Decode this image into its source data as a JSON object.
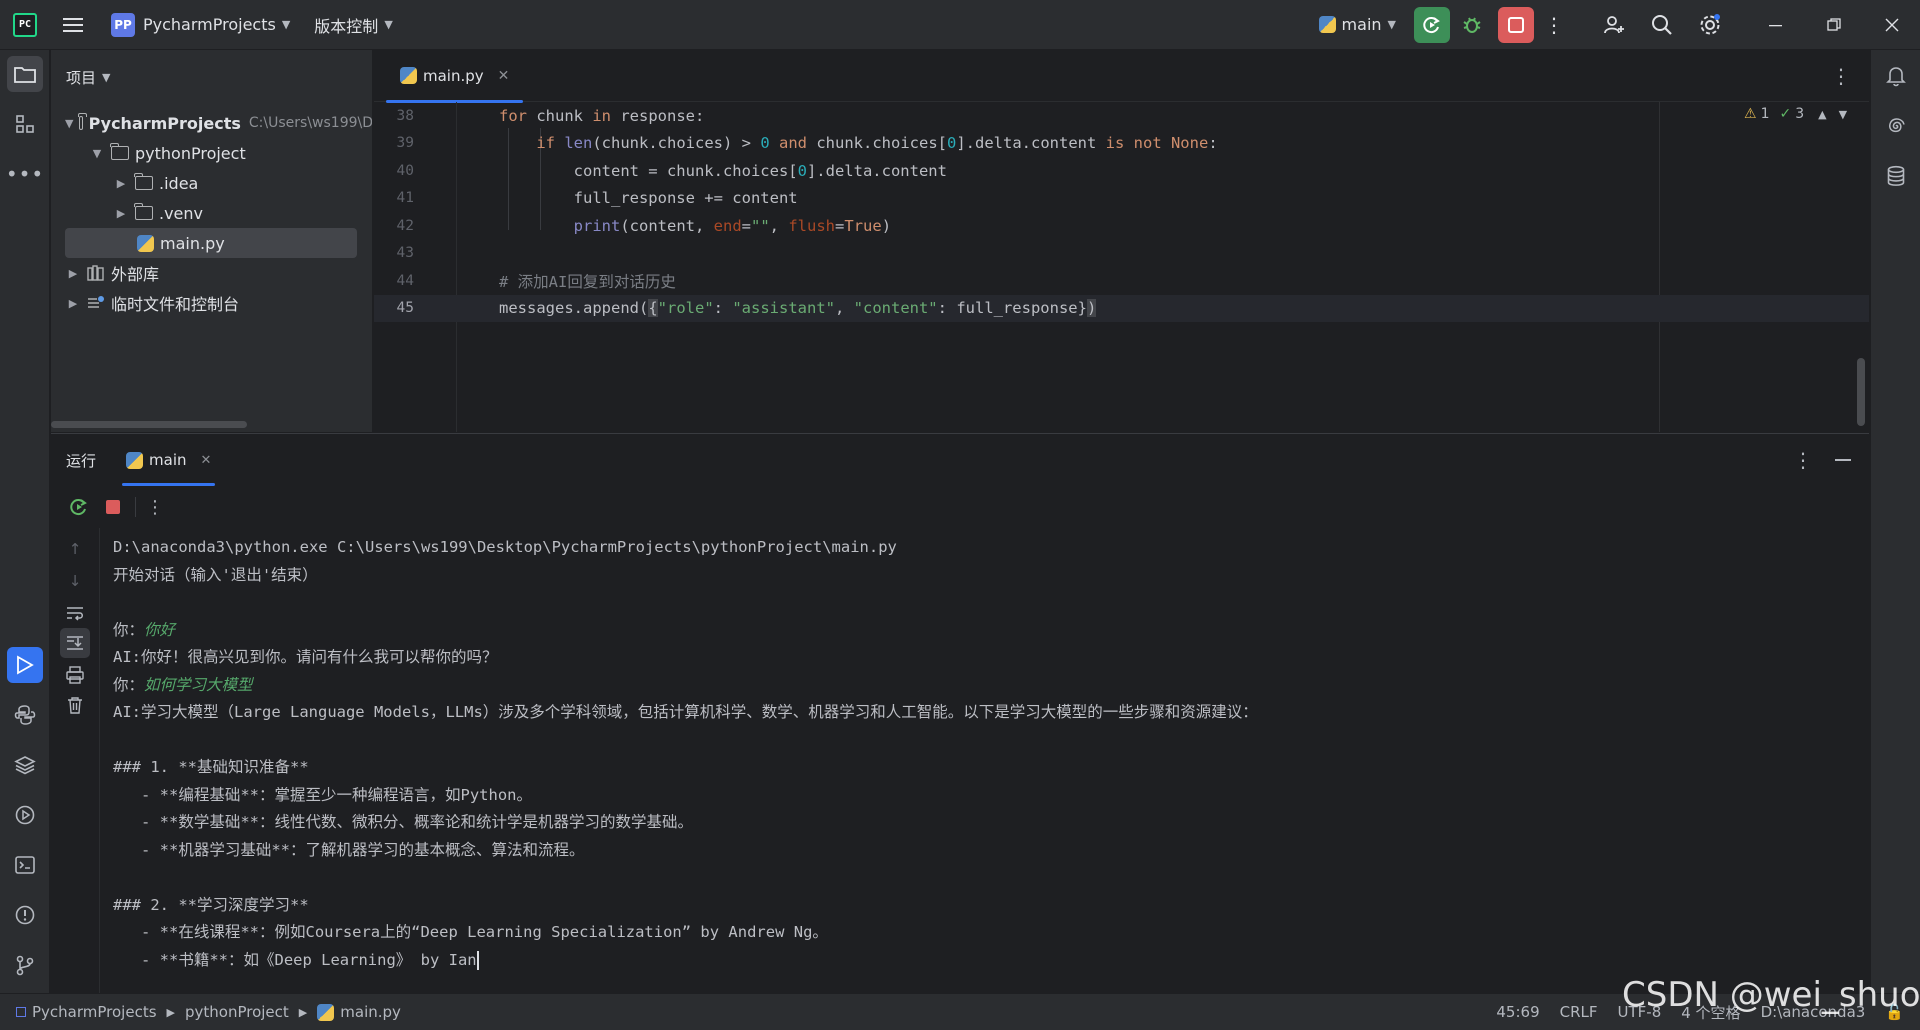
{
  "titlebar": {
    "project_badge": "PP",
    "project_name": "PycharmProjects",
    "vcs_label": "版本控制",
    "run_config": "main"
  },
  "project_panel": {
    "title": "项目",
    "tree": [
      {
        "label": "PycharmProjects",
        "hint": "C:\\Users\\ws199\\D"
      },
      {
        "label": "pythonProject"
      },
      {
        "label": ".idea"
      },
      {
        "label": ".venv"
      },
      {
        "label": "main.py"
      },
      {
        "label": "外部库"
      },
      {
        "label": "临时文件和控制台"
      }
    ]
  },
  "editor": {
    "tab_label": "main.py",
    "inspections": {
      "warnings": "1",
      "typos": "3"
    },
    "line_numbers": [
      "38",
      "39",
      "40",
      "41",
      "42",
      "43",
      "44",
      "45"
    ]
  },
  "run_panel": {
    "title": "运行",
    "tab_label": "main",
    "console": {
      "cmd": "D:\\anaconda3\\python.exe C:\\Users\\ws199\\Desktop\\PycharmProjects\\pythonProject\\main.py",
      "start": "开始对话（输入'退出'结束）",
      "you_prefix": "你：",
      "user_input_1": "你好",
      "ai_reply_1": "AI:你好！很高兴见到你。请问有什么我可以帮你的吗？",
      "user_input_2": "如何学习大模型",
      "ai_reply_2": "AI:学习大模型（Large Language Models，LLMs）涉及多个学科领域，包括计算机科学、数学、机器学习和人工智能。以下是学习大模型的一些步骤和资源建议：",
      "h1": "### 1. **基础知识准备**",
      "b1": "   - **编程基础**：掌握至少一种编程语言，如Python。",
      "b2": "   - **数学基础**：线性代数、微积分、概率论和统计学是机器学习的数学基础。",
      "b3": "   - **机器学习基础**：了解机器学习的基本概念、算法和流程。",
      "h2": "### 2. **学习深度学习**",
      "b4": "   - **在线课程**：例如Coursera上的“Deep Learning Specialization” by Andrew Ng。",
      "b5": "   - **书籍**：如《Deep Learning》 by Ian"
    }
  },
  "statusbar": {
    "crumb_1": "PycharmProjects",
    "crumb_2": "pythonProject",
    "crumb_3": "main.py",
    "position": "45:69",
    "line_sep": "CRLF",
    "encoding": "UTF-8",
    "indent": "4 个空格",
    "interpreter": "D:\\anaconda3"
  },
  "watermark": "CSDN @wei_shuo"
}
